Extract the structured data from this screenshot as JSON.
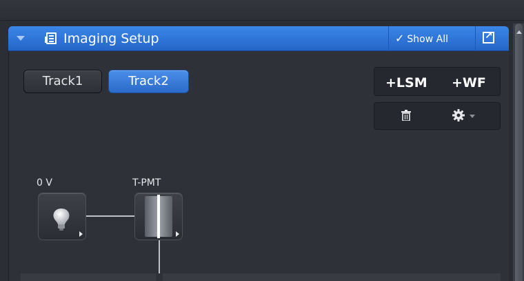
{
  "panel": {
    "title": "Imaging Setup",
    "show_all_label": "Show All"
  },
  "tracks": [
    {
      "label": "Track1",
      "selected": false
    },
    {
      "label": "Track2",
      "selected": true
    }
  ],
  "actions": {
    "add_lsm_label": "+LSM",
    "add_wf_label": "+WF"
  },
  "devices": [
    {
      "label": "0 V",
      "icon": "lightbulb-icon"
    },
    {
      "label": "T-PMT",
      "icon": "detector-icon"
    }
  ],
  "colors": {
    "header_accent": "#2b6ac9",
    "background": "#2e3138"
  }
}
